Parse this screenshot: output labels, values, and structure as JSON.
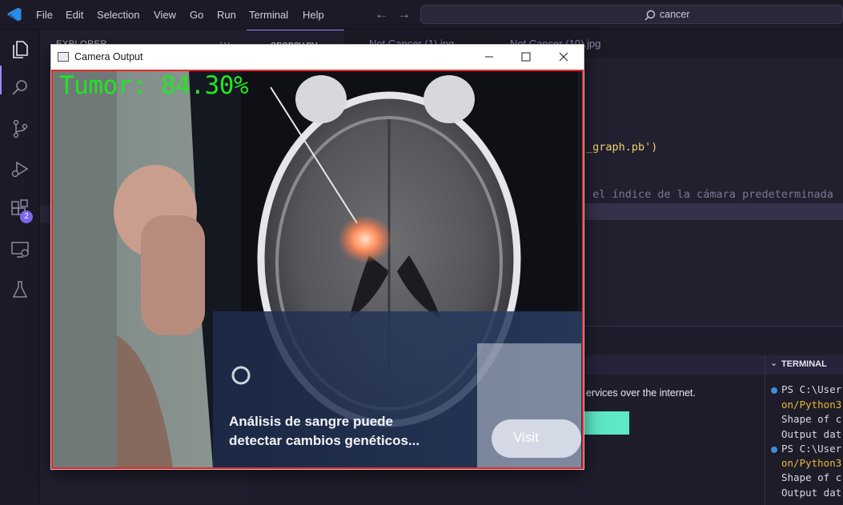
{
  "menu": {
    "items": [
      "File",
      "Edit",
      "Selection",
      "View",
      "Go",
      "Run",
      "Terminal",
      "Help"
    ]
  },
  "search": {
    "text": "cancer"
  },
  "activity": {
    "extensions_badge": "2"
  },
  "sidebar": {
    "title": "EXPLORER"
  },
  "editor": {
    "tabs": [
      {
        "label": "opencv.py"
      },
      {
        "label": "Not Cancer  (1).jpg"
      },
      {
        "label": "Not Cancer  (10).jpg"
      }
    ],
    "code_lines": [
      {
        "text": "_graph.pb')"
      },
      {
        "text": " el índice de la cámara predeterminada"
      }
    ]
  },
  "panel": {
    "welcome_text": "ervices over the internet.",
    "terminal": {
      "title": "TERMINAL",
      "lines": [
        {
          "prefix": "PS C:\\User",
          "path": ""
        },
        {
          "prefix": "",
          "path": "on/Python3"
        },
        {
          "prefix": "Shape of c",
          "path": ""
        },
        {
          "prefix": "Output dat",
          "path": ""
        },
        {
          "prefix": "PS C:\\User",
          "path": ""
        },
        {
          "prefix": "",
          "path": "on/Python3"
        },
        {
          "prefix": "Shape of c",
          "path": ""
        },
        {
          "prefix": "Output dat",
          "path": ""
        }
      ]
    }
  },
  "camera_window": {
    "title": "Camera Output",
    "tumor_label": "Tumor: 84.30%",
    "overlay_text_line1": "Análisis de sangre puede",
    "overlay_text_line2": "detectar cambios genéticos...",
    "overlay_button": "Visit",
    "colors": {
      "border": "#e52828",
      "label": "#22e622"
    }
  }
}
